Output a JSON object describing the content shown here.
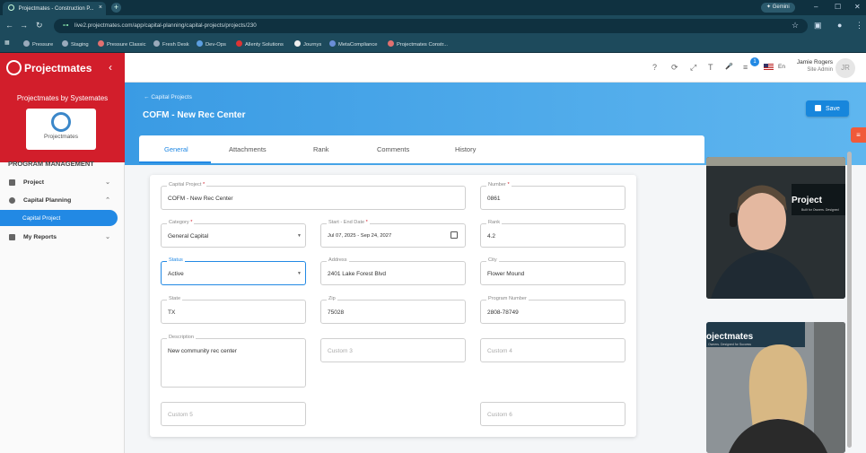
{
  "browser": {
    "tab_title": "Projectmates - Construction P...",
    "tab_close": "×",
    "new_tab": "+",
    "gemini_label": "Gemini",
    "url": "live2.projectmates.com/app/capital-planning/capital-projects/projects/230",
    "win_min": "–",
    "win_max": "☐",
    "win_close": "✕",
    "nav_back": "←",
    "nav_forward": "→",
    "nav_reload": "↻",
    "bookmarks": [
      {
        "label": "Pressure",
        "color": "#9ab"
      },
      {
        "label": "Staging",
        "color": "#9ab"
      },
      {
        "label": "Pressure Classic",
        "color": "#e07070"
      },
      {
        "label": "Fresh Desk",
        "color": "#9ab"
      },
      {
        "label": "Dev-Ops",
        "color": "#5b9ee0"
      },
      {
        "label": "Allenty Solutions",
        "color": "#d33"
      },
      {
        "label": "Journys",
        "color": "#eee"
      },
      {
        "label": "MetaCompliance",
        "color": "#6a8ed8"
      },
      {
        "label": "Projectmates Constr...",
        "color": "#e07070"
      }
    ]
  },
  "sidebar": {
    "brand": "Projectmates",
    "collapse_icon": "‹",
    "by_line": "Projectmates by Systemates",
    "card_label": "Projectmates",
    "section": "PROGRAM MANAGEMENT",
    "items": [
      {
        "label": "Project",
        "chevron": "⌄"
      },
      {
        "label": "Capital Planning",
        "chevron": "⌃"
      },
      {
        "label": "My Reports",
        "chevron": "⌄"
      }
    ],
    "active_sub": "Capital Project"
  },
  "topbar": {
    "icons": [
      "?",
      "⟳",
      "⤢",
      "T",
      "🎤",
      "≡"
    ],
    "notification_count": "1",
    "language": "En",
    "user_name": "Jamie Rogers",
    "user_role": "Site Admin",
    "avatar_initials": "JR"
  },
  "header": {
    "breadcrumb": "Capital Projects",
    "back_arrow": "←",
    "title": "COFM - New Rec Center",
    "save_label": "Save"
  },
  "tabs": [
    "General",
    "Attachments",
    "Rank",
    "Comments",
    "History"
  ],
  "active_tab": "General",
  "form": {
    "capital_project": {
      "label": "Capital Project",
      "value": "COFM - New Rec Center",
      "required": "*"
    },
    "number": {
      "label": "Number",
      "value": "0861",
      "required": "*"
    },
    "category": {
      "label": "Category",
      "value": "General Capital",
      "required": "*"
    },
    "dates": {
      "label": "Start - End Date",
      "value": "Jul 07, 2025 - Sep 24, 2027",
      "required": "*"
    },
    "rank": {
      "label": "Rank",
      "value": "4.2"
    },
    "status": {
      "label": "Status",
      "value": "Active"
    },
    "address": {
      "label": "Address",
      "value": "2401 Lake Forest Blvd"
    },
    "city": {
      "label": "City",
      "value": "Flower Mound"
    },
    "state": {
      "label": "State",
      "value": "TX"
    },
    "zip": {
      "label": "Zip",
      "value": "75028"
    },
    "program_number": {
      "label": "Program Number",
      "value": "2808-78749"
    },
    "description": {
      "label": "Description",
      "value": "New community rec center"
    },
    "custom3": {
      "placeholder": "Custom 3"
    },
    "custom4": {
      "placeholder": "Custom 4"
    },
    "custom5": {
      "placeholder": "Custom 5"
    },
    "custom6": {
      "placeholder": "Custom 6"
    }
  },
  "video": {
    "top_logo": "Project",
    "top_sub": "Built for Owners. Designed",
    "bottom_logo": "ojectmates",
    "bottom_sub": "Owners. Designed for Success"
  }
}
